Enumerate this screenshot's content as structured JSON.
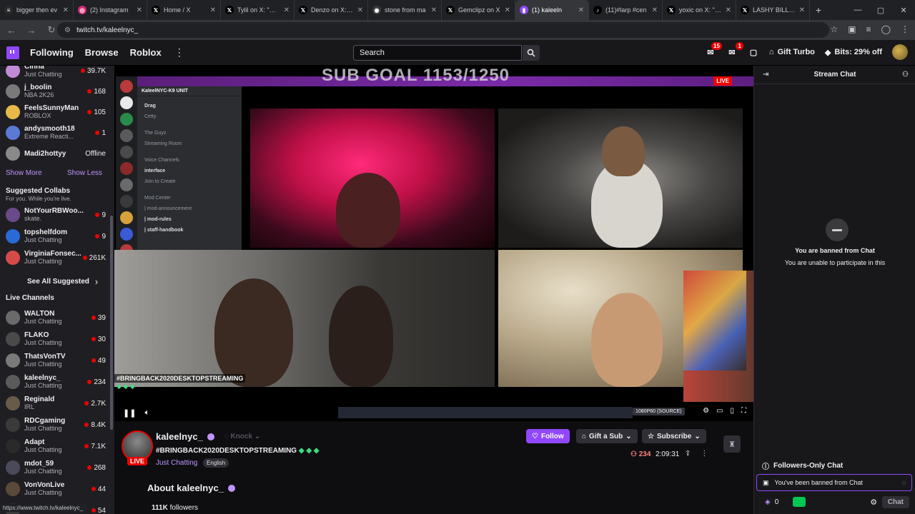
{
  "browser": {
    "tabs": [
      {
        "title": "bigger then ev",
        "color": "#2b2b2b",
        "glyph": "≡"
      },
      {
        "title": "(2) Instagram",
        "color": "#d62976",
        "glyph": "◎"
      },
      {
        "title": "Home / X",
        "color": "#000000",
        "glyph": "𝕏"
      },
      {
        "title": "Tylil on X: \"Ahh",
        "color": "#000000",
        "glyph": "𝕏"
      },
      {
        "title": "Denzo on X: \"Li",
        "color": "#000000",
        "glyph": "𝕏"
      },
      {
        "title": "stone from ma",
        "color": "#3a3a3a",
        "glyph": "◉"
      },
      {
        "title": "Gemclipz on X",
        "color": "#000000",
        "glyph": "𝕏"
      },
      {
        "title": "(1) kaleeln",
        "color": "#9147ff",
        "glyph": "▮",
        "active": true
      },
      {
        "title": "(11)#larp #cen",
        "color": "#000000",
        "glyph": "♪"
      },
      {
        "title": "yoxic on X: \"Yo",
        "color": "#000000",
        "glyph": "𝕏"
      },
      {
        "title": "LASHY BILLS o",
        "color": "#000000",
        "glyph": "𝕏"
      }
    ],
    "url": "twitch.tv/kaleelnyc_",
    "status_url": "https://www.twitch.tv/kaleelnyc_"
  },
  "nav": {
    "following": "Following",
    "browse": "Browse",
    "roblox": "Roblox",
    "search_placeholder": "Search",
    "inbox_badge": "15",
    "notif_badge": "1",
    "gift_turbo": "Gift Turbo",
    "bits": "Bits: 29% off"
  },
  "sidebar": {
    "top_channels": [
      {
        "name": "Cinna",
        "category": "Just Chatting",
        "count": "39.7K",
        "color": "#c08ad6"
      },
      {
        "name": "j_boolin",
        "category": "NBA 2K26",
        "count": "168",
        "color": "#7a7a7a"
      },
      {
        "name": "FeelsSunnyMan",
        "category": "ROBLOX",
        "count": "105",
        "color": "#e8b84a"
      },
      {
        "name": "andysmooth18",
        "category": "Extreme Reacti...",
        "count": "1",
        "color": "#5a7ad6"
      },
      {
        "name": "Madi2hottyy",
        "category": "",
        "count": "Offline",
        "color": "#8a8a8a"
      }
    ],
    "show_more": "Show More",
    "show_less": "Show Less",
    "suggested_collabs": "Suggested Collabs",
    "suggested_sub": "For you. While you're live.",
    "suggested": [
      {
        "name": "NotYourRBWoo...",
        "category": "skate.",
        "count": "9",
        "color": "#6a4a8a"
      },
      {
        "name": "topshelfdom",
        "category": "Just Chatting",
        "count": "9",
        "color": "#2a6ad6"
      },
      {
        "name": "VirginiaFonsec...",
        "category": "Just Chatting",
        "count": "261K",
        "color": "#d64a4a"
      }
    ],
    "see_all": "See All Suggested",
    "live_channels": "Live Channels",
    "live": [
      {
        "name": "WALTON",
        "category": "Just Chatting",
        "count": "39",
        "color": "#6a6a6a"
      },
      {
        "name": "FLAKO",
        "category": "Just Chatting",
        "count": "30",
        "color": "#4a4a4a"
      },
      {
        "name": "ThatsVonTV",
        "category": "Just Chatting",
        "count": "49",
        "color": "#7a7a7a"
      },
      {
        "name": "kaleelnyc_",
        "category": "Just Chatting",
        "count": "234",
        "color": "#5a5a5a"
      },
      {
        "name": "Reginald",
        "category": "IRL",
        "count": "2.7K",
        "color": "#6a5a4a"
      },
      {
        "name": "RDCgaming",
        "category": "Just Chatting",
        "count": "8.4K",
        "color": "#3a3a3a"
      },
      {
        "name": "Adapt",
        "category": "Just Chatting",
        "count": "7.1K",
        "color": "#2a2a2a"
      },
      {
        "name": "mdot_59",
        "category": "Just Chatting",
        "count": "268",
        "color": "#4a4a5a"
      },
      {
        "name": "VonVonLive",
        "category": "Just Chatting",
        "count": "44",
        "color": "#5a4a3a"
      },
      {
        "name": "",
        "category": "",
        "count": "54",
        "color": "#3a3a3a"
      }
    ]
  },
  "video": {
    "sub_goal": "SUB GOAL 1153/1250",
    "live": "LIVE",
    "discord_server": "KaleelNYC-K9 UNIT",
    "discord_channels": [
      {
        "label": "Drag",
        "bold": true
      },
      {
        "label": "Cetty",
        "bold": false
      },
      {
        "label": "The Guyz",
        "bold": false
      },
      {
        "label": "Streaming Room",
        "bold": false
      },
      {
        "label": "Voice Channels",
        "bold": false
      },
      {
        "label": "interface",
        "bold": true
      },
      {
        "label": "Join to Create",
        "bold": false
      },
      {
        "label": "Mod Center",
        "bold": false
      },
      {
        "label": "| mod-announcement",
        "bold": false
      },
      {
        "label": "| mod-rules",
        "bold": true
      },
      {
        "label": "| staff-handbook",
        "bold": true
      }
    ],
    "hashtag": "#BRINGBACK2020DESKTOPSTREAMING",
    "quality": "1080P60 (SOURCE)"
  },
  "stream": {
    "channel": "kaleelnyc_",
    "knock": "Knock",
    "title": "#BRINGBACK2020DESKTOPSTREAMING",
    "category": "Just Chatting",
    "language": "English",
    "live_tag": "LIVE",
    "follow": "Follow",
    "gift": "Gift a Sub",
    "subscribe": "Subscribe",
    "viewers": "234",
    "uptime": "2:09:31",
    "about": "About kaleelnyc_",
    "followers_count": "111K",
    "followers_label": "followers"
  },
  "chat": {
    "header": "Stream Chat",
    "banned_title": "You are banned from Chat",
    "banned_sub": "You are unable to participate in this",
    "followers_only": "Followers-Only Chat",
    "banned_input": "You've been banned from Chat",
    "points": "0",
    "chat_button": "Chat"
  }
}
